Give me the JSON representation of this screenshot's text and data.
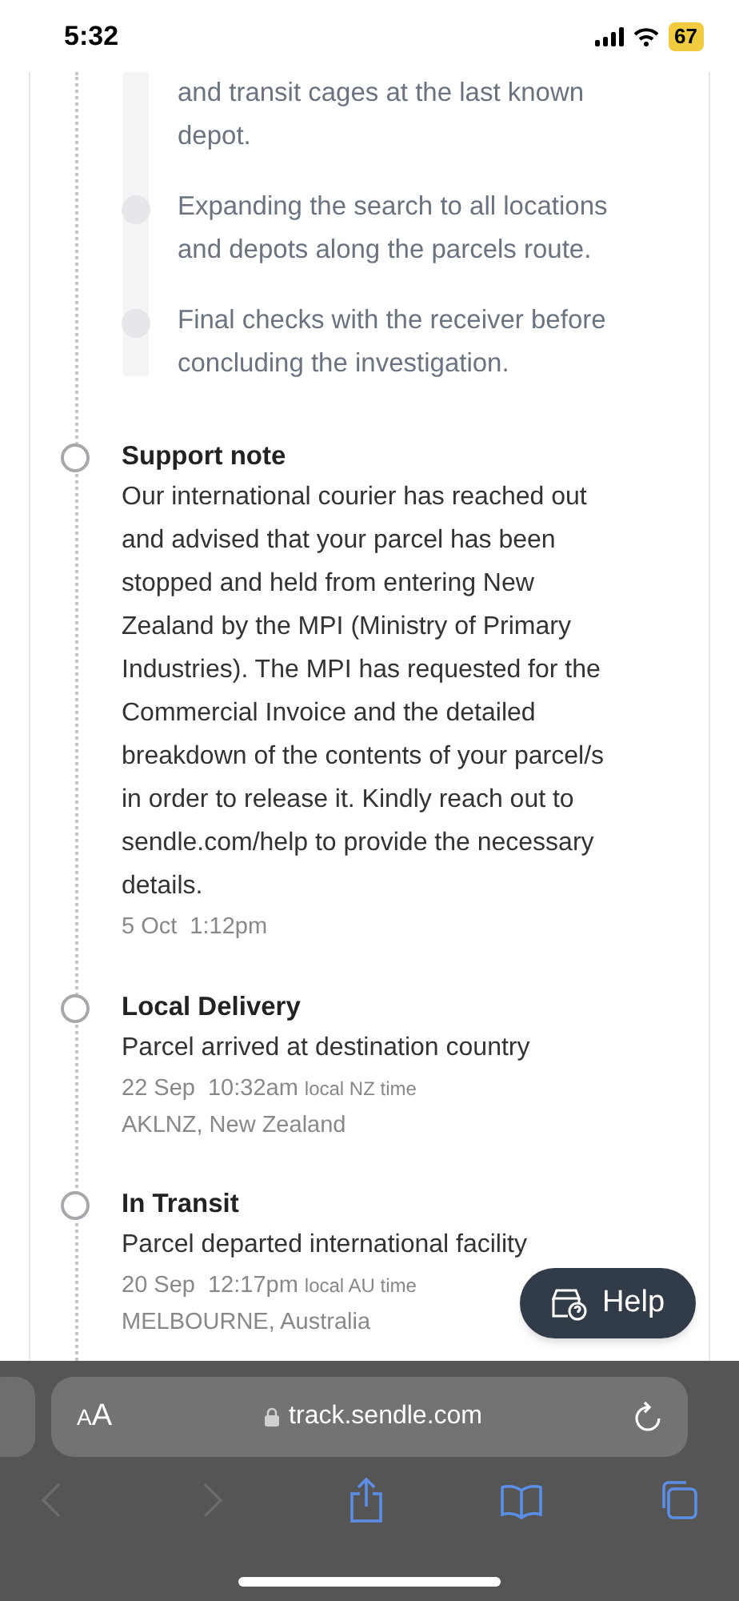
{
  "status_bar": {
    "time": "5:32",
    "battery": "67"
  },
  "substeps": [
    {
      "text": "and transit cages at the last known depot.",
      "partial": true
    },
    {
      "text": "Expanding the search to all locations and depots along the parcels route.",
      "partial": false
    },
    {
      "text": "Final checks with the receiver before concluding the investigation.",
      "partial": false
    }
  ],
  "events": [
    {
      "title": "Support note",
      "body": "Our international courier has reached out and advised that your parcel has been stopped and held from entering New Zealand by the MPI (Ministry of Primary Industries). The MPI has requested for the Commercial Invoice and the detailed breakdown of the contents of your parcel/s in order to release it. Kindly reach out to sendle.com/help to provide the necessary details.",
      "date": "5 Oct",
      "time": "1:12pm"
    },
    {
      "title": "Local Delivery",
      "body": "Parcel arrived at destination country",
      "date": "22 Sep",
      "time": "10:32am",
      "time_note": "local NZ time",
      "location": "AKLNZ, New Zealand"
    },
    {
      "title": "In Transit",
      "body": "Parcel departed international facility",
      "date": "20 Sep",
      "time": "12:17pm",
      "time_note": "local AU time",
      "location": "MELBOURNE, Australia"
    }
  ],
  "help_button": "Help",
  "browser": {
    "text_size": "AA",
    "url": "track.sendle.com",
    "back_disabled": true,
    "forward_disabled": true
  }
}
